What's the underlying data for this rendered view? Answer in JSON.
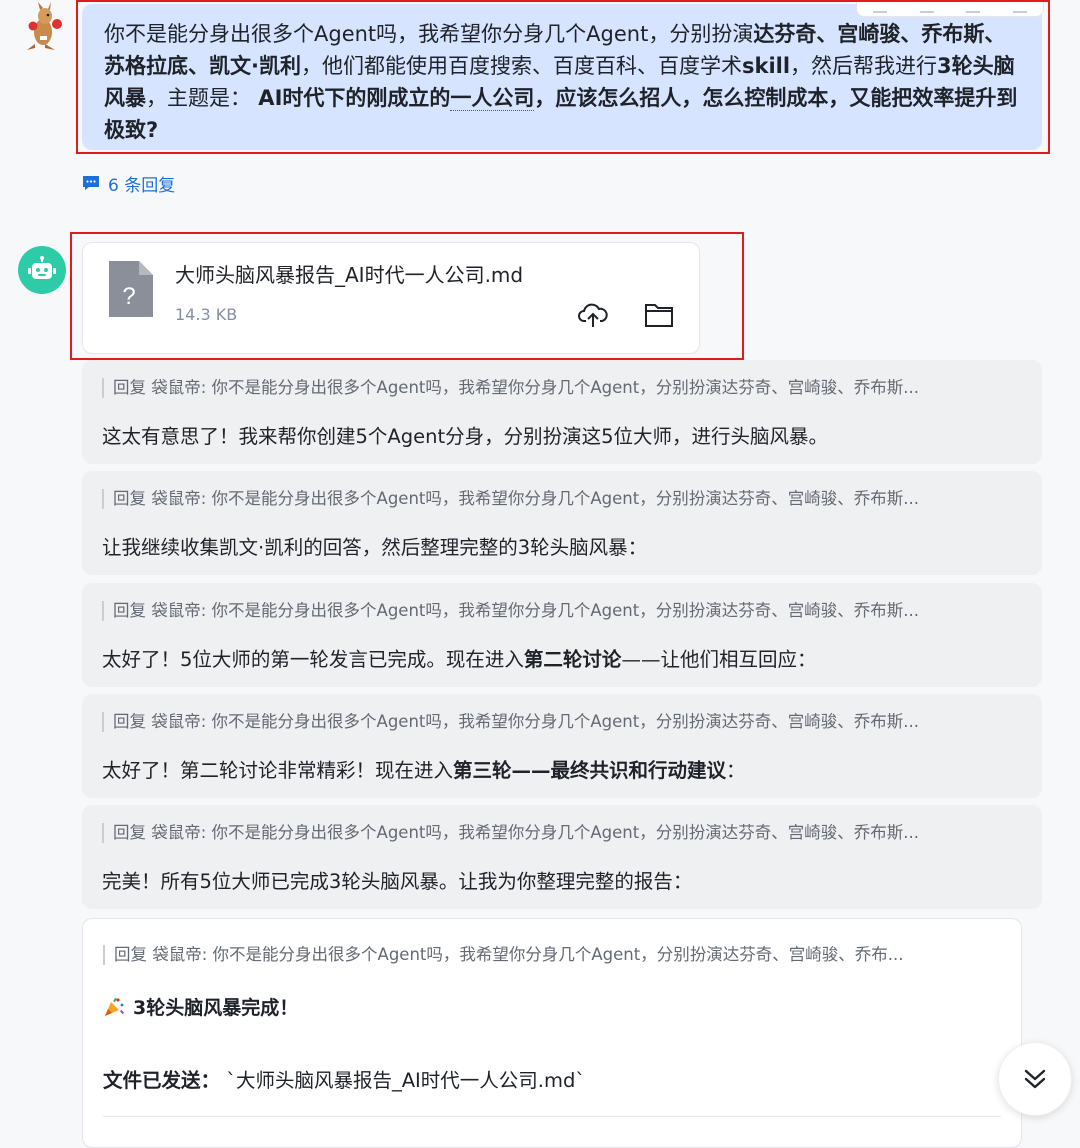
{
  "user_message": {
    "text_parts": [
      {
        "text": "你不是能分身出很多个Agent吗，我希望你分身几个Agent，分别扮演",
        "bold": false
      },
      {
        "text": "达芬奇、宫崎骏、乔布斯、苏格拉底、凯文·凯利",
        "bold": true
      },
      {
        "text": "，他们都能使用百度搜索、百度百科、百度学术",
        "bold": false
      },
      {
        "text": "skill",
        "bold": true
      },
      {
        "text": "，然后帮我进行",
        "bold": false
      },
      {
        "text": "3轮头脑风暴",
        "bold": true
      },
      {
        "text": "，主题是：",
        "bold": false
      },
      {
        "text": " AI时代下的刚成立的",
        "bold": true
      },
      {
        "text": "一人公司",
        "bold": true,
        "dotted": true
      },
      {
        "text": "，应该怎么招人，怎么控制成本，又能把效率提升到极致?",
        "bold": true
      }
    ]
  },
  "replies_link": "6 条回复",
  "file": {
    "name": "大师头脑风暴报告_AI时代一人公司.md",
    "size": "14.3 KB",
    "type_glyph": "?"
  },
  "quote_prefix": "回复 袋鼠帝: 你不是能分身出很多个Agent吗，我希望你分身几个Agent，分别扮演达芬奇、宫崎骏、乔布斯...",
  "messages": [
    {
      "parts": [
        {
          "text": "这太有意思了！我来帮你创建5个Agent分身，分别扮演这5位大师，进行头脑风暴。",
          "bold": false
        }
      ]
    },
    {
      "parts": [
        {
          "text": "让我继续收集凯文·凯利的回答，然后整理完整的3轮头脑风暴：",
          "bold": false
        }
      ]
    },
    {
      "parts": [
        {
          "text": "太好了！5位大师的第一轮发言已完成。现在进入",
          "bold": false
        },
        {
          "text": "第二轮讨论",
          "bold": true
        },
        {
          "text": "——让他们相互回应：",
          "bold": false
        }
      ]
    },
    {
      "parts": [
        {
          "text": "太好了！第二轮讨论非常精彩！现在进入",
          "bold": false
        },
        {
          "text": "第三轮——最终共识和行动建议",
          "bold": true
        },
        {
          "text": "：",
          "bold": false
        }
      ]
    },
    {
      "parts": [
        {
          "text": "完美！所有5位大师已完成3轮头脑风暴。让我为你整理完整的报告：",
          "bold": false
        }
      ]
    }
  ],
  "final": {
    "quote": "回复 袋鼠帝: 你不是能分身出很多个Agent吗，我希望你分身几个Agent，分别扮演达芬奇、宫崎骏、乔布...",
    "done_text": "3轮头脑风暴完成！",
    "sent_label": "文件已发送：",
    "sent_value": " `大师头脑风暴报告_AI时代一人公司.md`"
  },
  "colors": {
    "user_bubble": "#d6e4ff",
    "bot_avatar": "#2ecba8",
    "link": "#1f6fdb",
    "highlight": "#e31b1b"
  }
}
